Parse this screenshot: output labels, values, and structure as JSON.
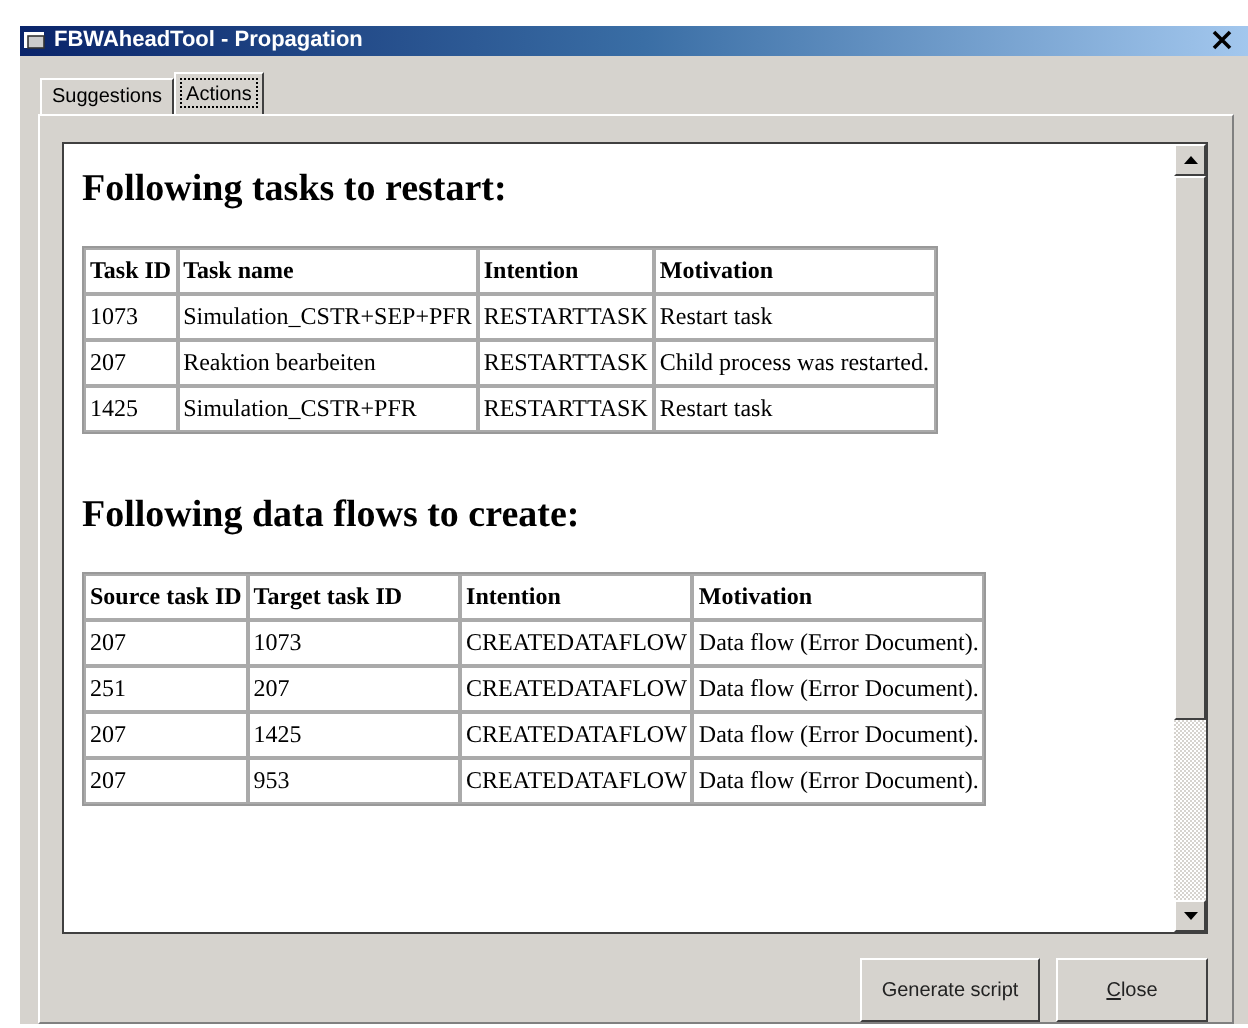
{
  "window": {
    "title": "FBWAheadTool - Propagation"
  },
  "tabs": [
    {
      "label": "Suggestions",
      "selected": false
    },
    {
      "label": "Actions",
      "selected": true
    }
  ],
  "sections": [
    {
      "heading": "Following tasks to restart:",
      "columns": [
        "Task ID",
        "Task name",
        "Intention",
        "Motivation"
      ],
      "rows": [
        [
          "1073",
          "Simulation_CSTR+SEP+PFR",
          "RESTARTTASK",
          "Restart task"
        ],
        [
          "207",
          "Reaktion bearbeiten",
          "RESTARTTASK",
          "Child process was restarted."
        ],
        [
          "1425",
          "Simulation_CSTR+PFR",
          "RESTARTTASK",
          "Restart task"
        ]
      ]
    },
    {
      "heading": "Following data flows to create:",
      "columns": [
        "Source task ID",
        "Target task ID",
        "Intention",
        "Motivation"
      ],
      "rows": [
        [
          "207",
          "1073",
          "CREATEDATAFLOW",
          "Data flow (Error Document)."
        ],
        [
          "251",
          "207",
          "CREATEDATAFLOW",
          "Data flow (Error Document)."
        ],
        [
          "207",
          "1425",
          "CREATEDATAFLOW",
          "Data flow (Error Document)."
        ],
        [
          "207",
          "953",
          "CREATEDATAFLOW",
          "Data flow (Error Document)."
        ]
      ]
    }
  ],
  "buttons": [
    "Generate script",
    "Close"
  ]
}
